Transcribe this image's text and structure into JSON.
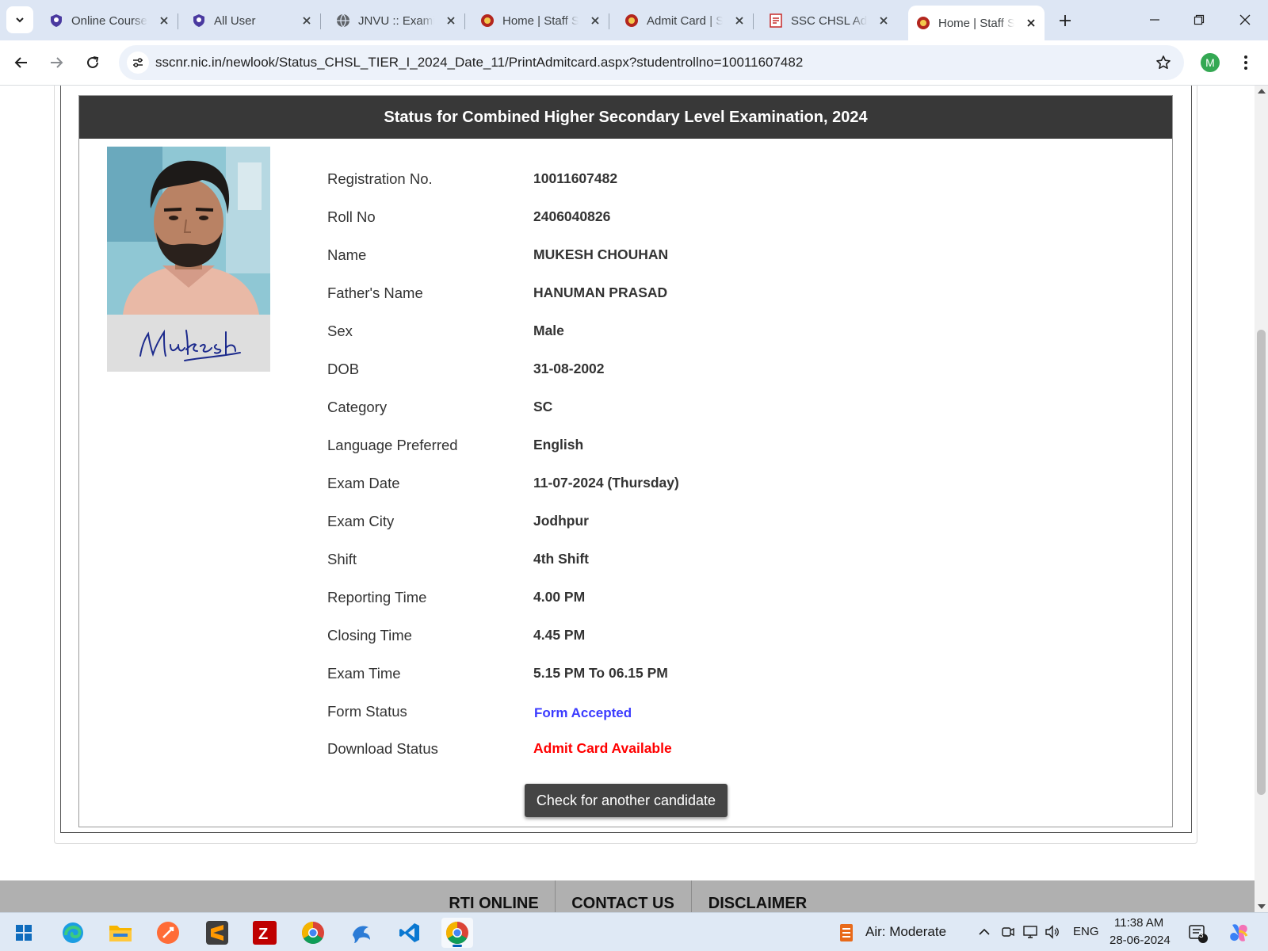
{
  "browser": {
    "tabs": [
      {
        "title": "Online Course",
        "favicon": "shield-logo-icon"
      },
      {
        "title": "All User",
        "favicon": "shield-logo-icon"
      },
      {
        "title": "JNVU :: Examin",
        "favicon": "globe-icon"
      },
      {
        "title": "Home | Staff S",
        "favicon": "emblem-icon"
      },
      {
        "title": "Admit Card | S",
        "favicon": "emblem-icon"
      },
      {
        "title": "SSC CHSL Adm",
        "favicon": "page-icon"
      },
      {
        "title": "Home | Staff S",
        "favicon": "emblem-icon",
        "active": true
      }
    ],
    "url": "sscnr.nic.in/newlook/Status_CHSL_TIER_I_2024_Date_11/PrintAdmitcard.aspx?studentrollno=10011607482",
    "profile_initial": "M"
  },
  "page": {
    "header": "Status for Combined Higher Secondary Level Examination, 2024",
    "signature_text": "Mukesh",
    "details": [
      {
        "label": "Registration No.",
        "value": "10011607482",
        "style": ""
      },
      {
        "label": "Roll No",
        "value": "2406040826",
        "style": ""
      },
      {
        "label": "Name",
        "value": "MUKESH CHOUHAN",
        "style": ""
      },
      {
        "label": "Father's Name",
        "value": "HANUMAN PRASAD",
        "style": ""
      },
      {
        "label": "Sex",
        "value": "Male",
        "style": ""
      },
      {
        "label": "DOB",
        "value": "31-08-2002",
        "style": ""
      },
      {
        "label": "Category",
        "value": "SC",
        "style": ""
      },
      {
        "label": "Language Preferred",
        "value": "English",
        "style": ""
      },
      {
        "label": "Exam Date",
        "value": "11-07-2024 (Thursday)",
        "style": ""
      },
      {
        "label": "Exam City",
        "value": "Jodhpur",
        "style": ""
      },
      {
        "label": "Shift",
        "value": "4th Shift",
        "style": ""
      },
      {
        "label": "Reporting Time",
        "value": "4.00 PM",
        "style": ""
      },
      {
        "label": "Closing Time",
        "value": "4.45 PM",
        "style": ""
      },
      {
        "label": "Exam Time",
        "value": "5.15 PM To 06.15 PM",
        "style": ""
      },
      {
        "label": "Form Status",
        "value": "Form Accepted",
        "style": "blue"
      },
      {
        "label": "Download Status",
        "value": "Admit Card Available",
        "style": "red"
      }
    ],
    "check_button": "Check for another candidate",
    "footer_links": [
      "RTI ONLINE",
      "CONTACT US",
      "DISCLAIMER"
    ]
  },
  "taskbar": {
    "weather": "Air: Moderate",
    "language": "ENG",
    "time": "11:38 AM",
    "date": "28-06-2024",
    "notification_count": "3"
  },
  "colors": {
    "header_bg": "#383838",
    "form_status": "#3b3bff",
    "download_status": "#ff0000",
    "button_bg": "#444444",
    "footer_bg": "#b0b0b0",
    "tabstrip_bg": "#dde6f4"
  }
}
